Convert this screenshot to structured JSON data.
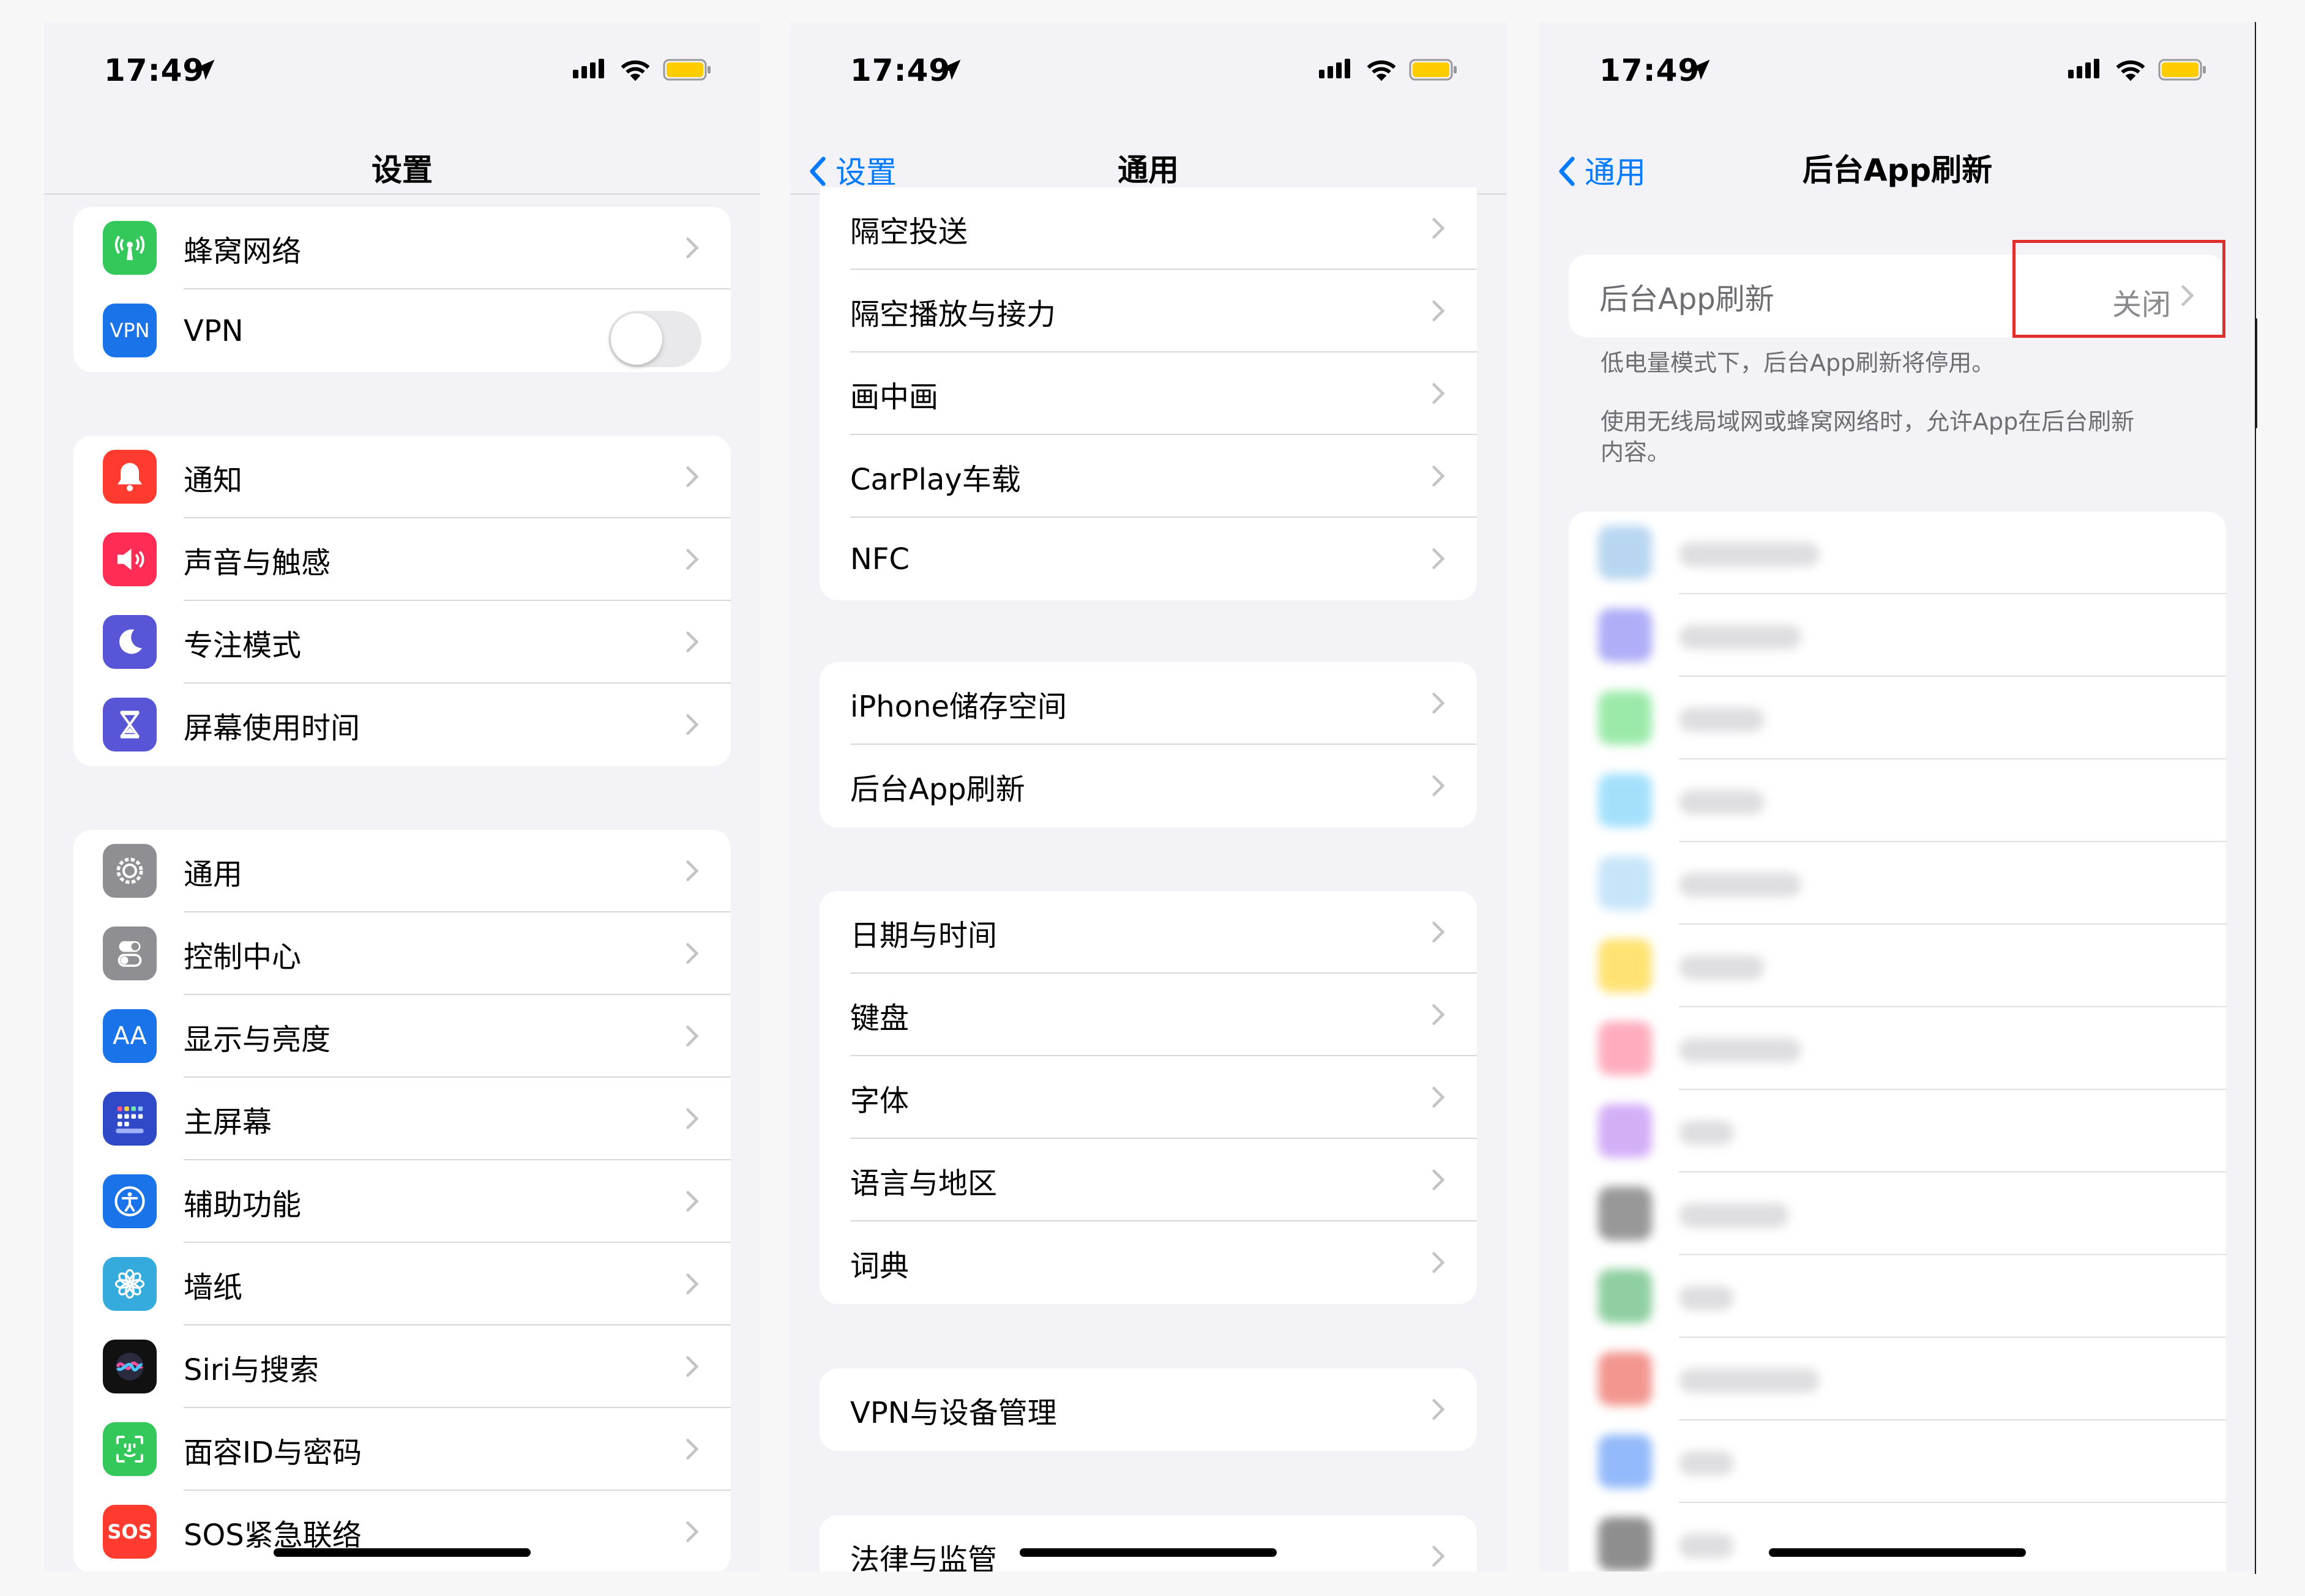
{
  "status": {
    "time": "17:49"
  },
  "screen1": {
    "title": "设置",
    "group_top": [
      {
        "label": "蜂窝网络",
        "icon": "cellular-icon",
        "color": "#34c759"
      },
      {
        "label": "VPN",
        "icon": "vpn-icon",
        "color": "#1a73e8",
        "icon_text": "VPN"
      }
    ],
    "group_notify": [
      {
        "label": "通知",
        "icon": "bell-icon",
        "color": "#ff3b30"
      },
      {
        "label": "声音与触感",
        "icon": "speaker-icon",
        "color": "#ff2d55"
      },
      {
        "label": "专注模式",
        "icon": "moon-icon",
        "color": "#5856d6"
      },
      {
        "label": "屏幕使用时间",
        "icon": "hourglass-icon",
        "color": "#5856d6"
      }
    ],
    "group_general": [
      {
        "label": "通用",
        "icon": "gear-icon",
        "color": "#8e8e93"
      },
      {
        "label": "控制中心",
        "icon": "switches-icon",
        "color": "#8e8e93"
      },
      {
        "label": "显示与亮度",
        "icon": "text-size-icon",
        "color": "#1a73e8",
        "icon_text": "AA"
      },
      {
        "label": "主屏幕",
        "icon": "home-grid-icon",
        "color": "#2f49c9"
      },
      {
        "label": "辅助功能",
        "icon": "accessibility-icon",
        "color": "#1a73e8"
      },
      {
        "label": "墙纸",
        "icon": "flower-icon",
        "color": "#35aadc"
      },
      {
        "label": "Siri与搜索",
        "icon": "siri-icon",
        "color": "#222"
      },
      {
        "label": "面容ID与密码",
        "icon": "face-id-icon",
        "color": "#34c759"
      },
      {
        "label": "SOS紧急联络",
        "icon": "sos-icon",
        "color": "#ff3b30",
        "icon_text": "SOS"
      }
    ]
  },
  "screen2": {
    "back": "设置",
    "title": "通用",
    "group_a": [
      "隔空投送",
      "隔空播放与接力",
      "画中画",
      "CarPlay车载",
      "NFC"
    ],
    "group_b": [
      "iPhone储存空间",
      "后台App刷新"
    ],
    "group_c": [
      "日期与时间",
      "键盘",
      "字体",
      "语言与地区",
      "词典"
    ],
    "group_d": [
      "VPN与设备管理"
    ],
    "group_e": [
      "法律与监管"
    ]
  },
  "screen3": {
    "back": "通用",
    "title": "后台App刷新",
    "row_label": "后台App刷新",
    "row_value": "关闭",
    "note1": "低电量模式下，后台App刷新将停用。",
    "note2": "使用无线局域网或蜂窝网络时，允许App在后台刷新内容。",
    "blurred_app_colors": [
      "#7fb6e6",
      "#6f6cf0",
      "#4cd964",
      "#5ac8fa",
      "#9ad0f5",
      "#ffcc00",
      "#ff6b8a",
      "#b06ef0",
      "#444",
      "#34a853",
      "#e94235",
      "#3b82f6",
      "#333"
    ]
  }
}
